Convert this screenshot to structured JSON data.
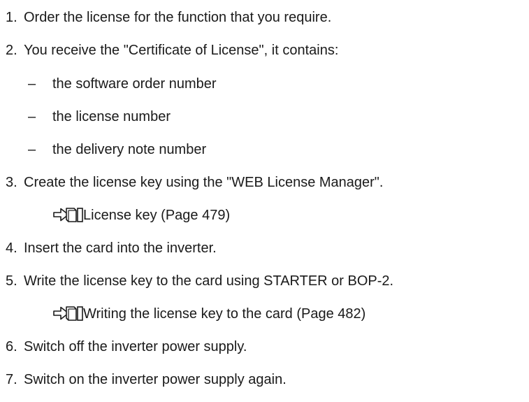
{
  "steps": [
    {
      "number": "1.",
      "text": "Order the license for the function that you require."
    },
    {
      "number": "2.",
      "text": "You receive the \"Certificate of License\", it contains:"
    },
    {
      "number": "3.",
      "text": "Create the license key using the \"WEB License Manager\"."
    },
    {
      "number": "4.",
      "text": "Insert the card into the inverter."
    },
    {
      "number": "5.",
      "text": "Write the license key to the card using STARTER or BOP-2."
    },
    {
      "number": "6.",
      "text": "Switch off the inverter power supply."
    },
    {
      "number": "7.",
      "text": "Switch on the inverter power supply again."
    }
  ],
  "sub_items": [
    {
      "bullet": "–",
      "text": "the software order number"
    },
    {
      "bullet": "–",
      "text": "the license number"
    },
    {
      "bullet": "–",
      "text": "the delivery note number"
    }
  ],
  "links": [
    {
      "icon": "cross-reference-icon",
      "text": "License key (Page 479)"
    },
    {
      "icon": "cross-reference-icon",
      "text": "Writing the license key to the card (Page 482)"
    }
  ]
}
